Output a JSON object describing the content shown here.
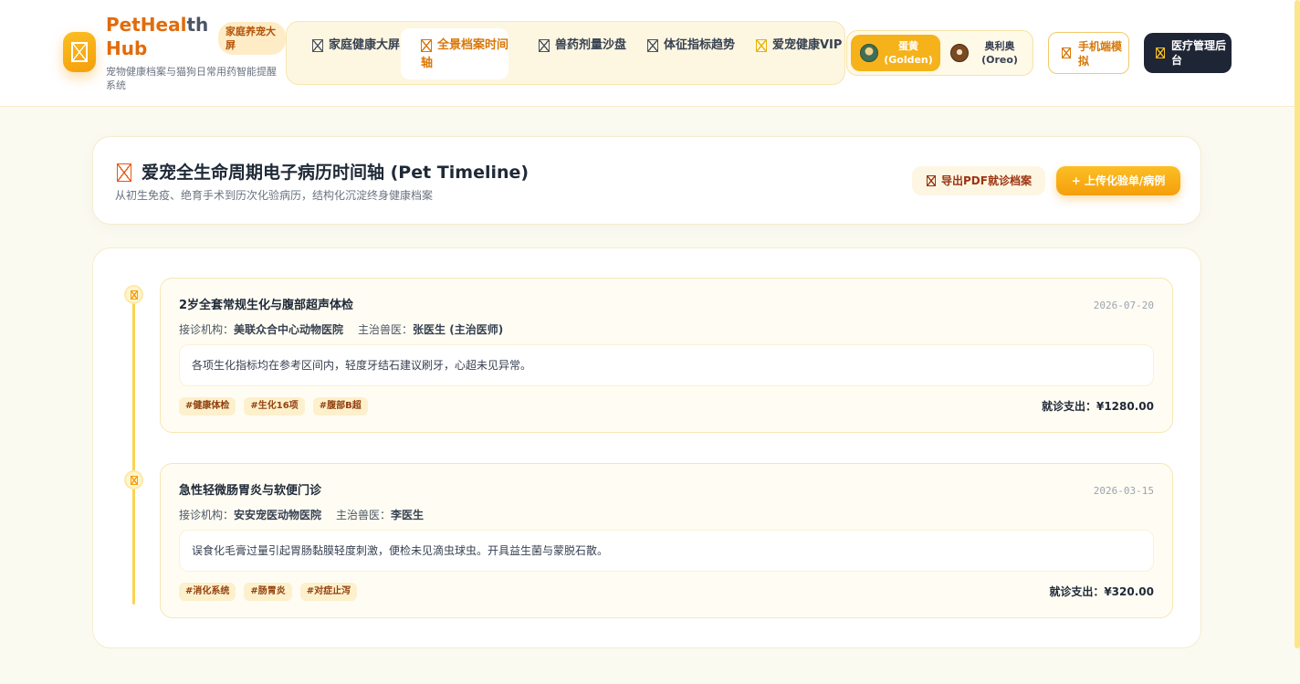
{
  "app": {
    "brand_main": "PetHeal",
    "brand_accent": "th",
    "brand_line2": "Hub",
    "badge": "家庭养宠大屏",
    "subtitle": "宠物健康档案与猫狗日常用药智能提醒系统"
  },
  "nav": [
    {
      "label": "家庭健康大屏",
      "icon": "dashboard-icon"
    },
    {
      "label": "全景档案时间轴",
      "icon": "timeline-icon",
      "active": true
    },
    {
      "label": "兽药剂量沙盘",
      "icon": "medicine-icon"
    },
    {
      "label": "体征指标趋势",
      "icon": "chart-icon"
    },
    {
      "label": "爱宠健康VIP",
      "icon": "crown-icon"
    }
  ],
  "pets": [
    {
      "name": "蛋黄 (Golden)",
      "active": true
    },
    {
      "name": "奥利奥 (Oreo)",
      "active": false
    }
  ],
  "actions": {
    "mobile": "手机端模拟",
    "admin": "医疗管理后台"
  },
  "page": {
    "title": "爱宠全生命周期电子病历时间轴 (Pet Timeline)",
    "description": "从初生免疫、绝育手术到历次化验病历，结构化沉淀终身健康档案",
    "export_label": "导出PDF就诊档案",
    "upload_label": "+ 上传化验单/病例"
  },
  "records": [
    {
      "title": "2岁全套常规生化与腹部超声体检",
      "date": "2026-07-20",
      "clinic_label": "接诊机构：",
      "clinic": "美联众合中心动物医院",
      "vet_label": "主治兽医：",
      "vet": "张医生 (主治医师)",
      "note": "各项生化指标均在参考区间内，轻度牙结石建议刷牙，心超未见异常。",
      "tags": [
        "#健康体检",
        "#生化16项",
        "#腹部B超"
      ],
      "cost": "就诊支出：¥1280.00"
    },
    {
      "title": "急性轻微肠胃炎与软便门诊",
      "date": "2026-03-15",
      "clinic_label": "接诊机构：",
      "clinic": "安安宠医动物医院",
      "vet_label": "主治兽医：",
      "vet": "李医生",
      "note": "误食化毛膏过量引起胃肠黏膜轻度刺激，便检未见滴虫球虫。开具益生菌与蒙脱石散。",
      "tags": [
        "#消化系统",
        "#肠胃炎",
        "#对症止泻"
      ],
      "cost": "就诊支出：¥320.00"
    }
  ],
  "colors": {
    "accent": "#f59e0b",
    "brand": "#e26b0a",
    "dark_button": "#1e2535"
  }
}
